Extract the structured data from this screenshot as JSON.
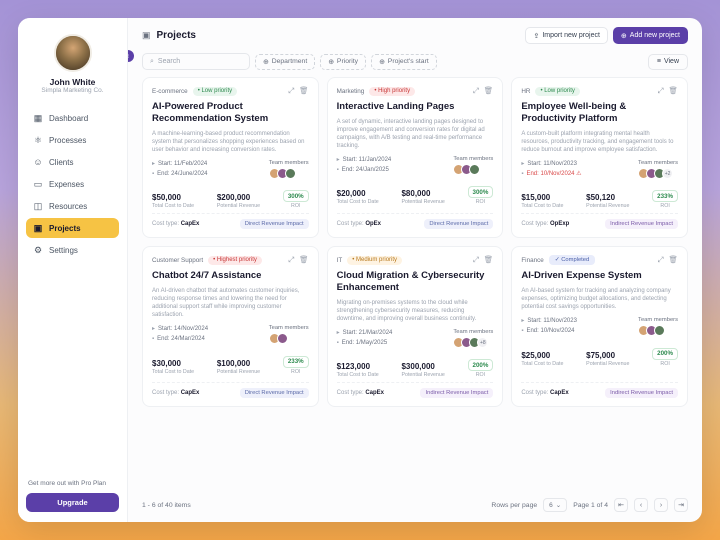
{
  "user": {
    "name": "John White",
    "company": "Simpla Marketing Co."
  },
  "sidebar": {
    "items": [
      {
        "label": "Dashboard",
        "icon": "▦"
      },
      {
        "label": "Processes",
        "icon": "⚛"
      },
      {
        "label": "Clients",
        "icon": "☺"
      },
      {
        "label": "Expenses",
        "icon": "▭"
      },
      {
        "label": "Resources",
        "icon": "◫"
      },
      {
        "label": "Projects",
        "icon": "▣"
      },
      {
        "label": "Settings",
        "icon": "⚙"
      }
    ],
    "pro_text": "Get more out with Pro Plan",
    "upgrade": "Upgrade"
  },
  "header": {
    "title": "Projects",
    "import": "Import new project",
    "add": "Add new project"
  },
  "filters": {
    "search_placeholder": "Search",
    "chips": [
      "Department",
      "Priority",
      "Project's start"
    ],
    "view": "View"
  },
  "labels": {
    "start": "Start:",
    "end": "End:",
    "team": "Team members",
    "cost": "Total Cost to Date",
    "rev": "Potential Revenue",
    "roi": "ROI",
    "cost_type": "Cost type:",
    "completed": "Completed"
  },
  "cards": [
    {
      "cat": "E-commerce",
      "prio": "Low priority",
      "prio_cls": "low",
      "title": "AI-Powered Product Recommendation System",
      "desc": "A machine-learning-based product recommendation system that personalizes shopping experiences based on user behavior and increasing conversion rates.",
      "start": "11/Feb/2024",
      "end": "24/June/2024",
      "cost": "$50,000",
      "rev": "$200,000",
      "roi": "300%",
      "type": "CapEx",
      "impact": "Direct Revenue Impact",
      "impact_cls": "",
      "avatars": 3,
      "extra": ""
    },
    {
      "cat": "Marketing",
      "prio": "High priority",
      "prio_cls": "high",
      "title": "Interactive Landing Pages",
      "desc": "A set of dynamic, interactive landing pages designed to improve engagement and conversion rates for digital ad campaigns, with A/B testing and real-time performance tracking.",
      "start": "11/Jan/2024",
      "end": "24/Jan/2025",
      "cost": "$20,000",
      "rev": "$80,000",
      "roi": "300%",
      "type": "OpEx",
      "impact": "Direct Revenue Impact",
      "impact_cls": "",
      "avatars": 3,
      "extra": ""
    },
    {
      "cat": "HR",
      "prio": "Low priority",
      "prio_cls": "low",
      "title": "Employee Well-being & Productivity Platform",
      "desc": "A custom-built platform integrating mental health resources, productivity tracking, and engagement tools to reduce burnout and improve employee satisfaction.",
      "start": "11/Nov/2023",
      "end": "10/Nov/2024",
      "end_red": true,
      "warn": true,
      "cost": "$15,000",
      "rev": "$50,120",
      "roi": "233%",
      "type": "OpExp",
      "impact": "Indirect Revenue Impact",
      "impact_cls": "ind",
      "avatars": 3,
      "extra": "+2"
    },
    {
      "cat": "Customer Support",
      "prio": "Highest priority",
      "prio_cls": "highest",
      "title": "Chatbot 24/7 Assistance",
      "desc": "An AI-driven chatbot that automates customer inquiries, reducing response times and lowering the need for additional support staff while improving customer satisfaction.",
      "start": "14/Nov/2024",
      "end": "24/Mar/2024",
      "cost": "$30,000",
      "rev": "$100,000",
      "roi": "233%",
      "type": "CapEx",
      "impact": "Direct Revenue Impact",
      "impact_cls": "",
      "avatars": 2,
      "extra": ""
    },
    {
      "cat": "IT",
      "prio": "Medium priority",
      "prio_cls": "medium",
      "title": "Cloud Migration & Cybersecurity Enhancement",
      "desc": "Migrating on-premises systems to the cloud while strengthening cybersecurity measures, reducing downtime, and improving overall business continuity.",
      "start": "21/Mar/2024",
      "end": "1/May/2025",
      "cost": "$123,000",
      "rev": "$300,000",
      "roi": "200%",
      "type": "CapEx",
      "impact": "Indirect Revenue Impact",
      "impact_cls": "ind",
      "avatars": 3,
      "extra": "+8"
    },
    {
      "cat": "Finance",
      "completed": true,
      "title": "AI-Driven Expense System",
      "desc": "An AI-based system for tracking and analyzing company expenses, optimizing budget allocations, and detecting potential cost savings opportunities.",
      "start": "11/Nov/2023",
      "end": "10/Nov/2024",
      "cost": "$25,000",
      "rev": "$75,000",
      "roi": "200%",
      "type": "CapEx",
      "impact": "Indirect Revenue Impact",
      "impact_cls": "ind",
      "avatars": 3,
      "extra": ""
    }
  ],
  "pager": {
    "summary": "1 - 6 of 40 items",
    "rpp_label": "Rows per page",
    "rpp_value": "6",
    "page_text": "Page 1 of 4"
  }
}
